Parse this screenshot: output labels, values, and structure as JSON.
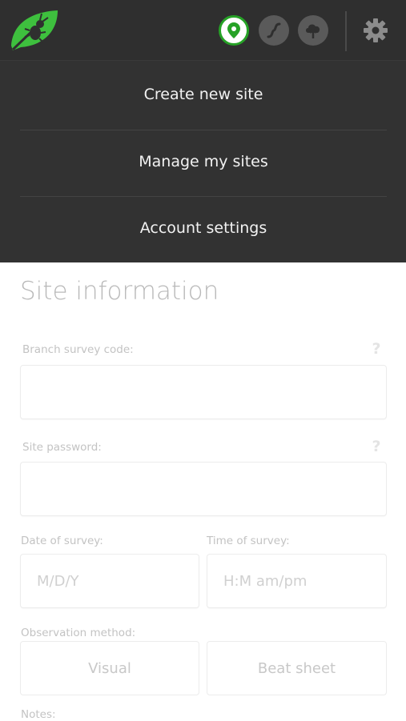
{
  "header": {
    "icons": {
      "logo": "leaf-bug-logo",
      "map": "map-pin-icon",
      "route": "route-icon",
      "upload": "cloud-upload-icon",
      "settings": "gear-icon"
    },
    "active_color": "#26a226"
  },
  "menu": {
    "items": [
      {
        "label": "Create new site"
      },
      {
        "label": "Manage my sites"
      },
      {
        "label": "Account settings"
      }
    ]
  },
  "form": {
    "title": "Site information",
    "branch_code": {
      "label": "Branch survey code:",
      "value": "",
      "help": "?"
    },
    "password": {
      "label": "Site password:",
      "value": "",
      "help": "?"
    },
    "date": {
      "label": "Date of survey:",
      "placeholder": "M/D/Y"
    },
    "time": {
      "label": "Time of survey:",
      "placeholder": "H:M am/pm"
    },
    "observation": {
      "label": "Observation method:",
      "options": [
        "Visual",
        "Beat sheet"
      ]
    },
    "notes": {
      "label": "Notes:"
    }
  }
}
